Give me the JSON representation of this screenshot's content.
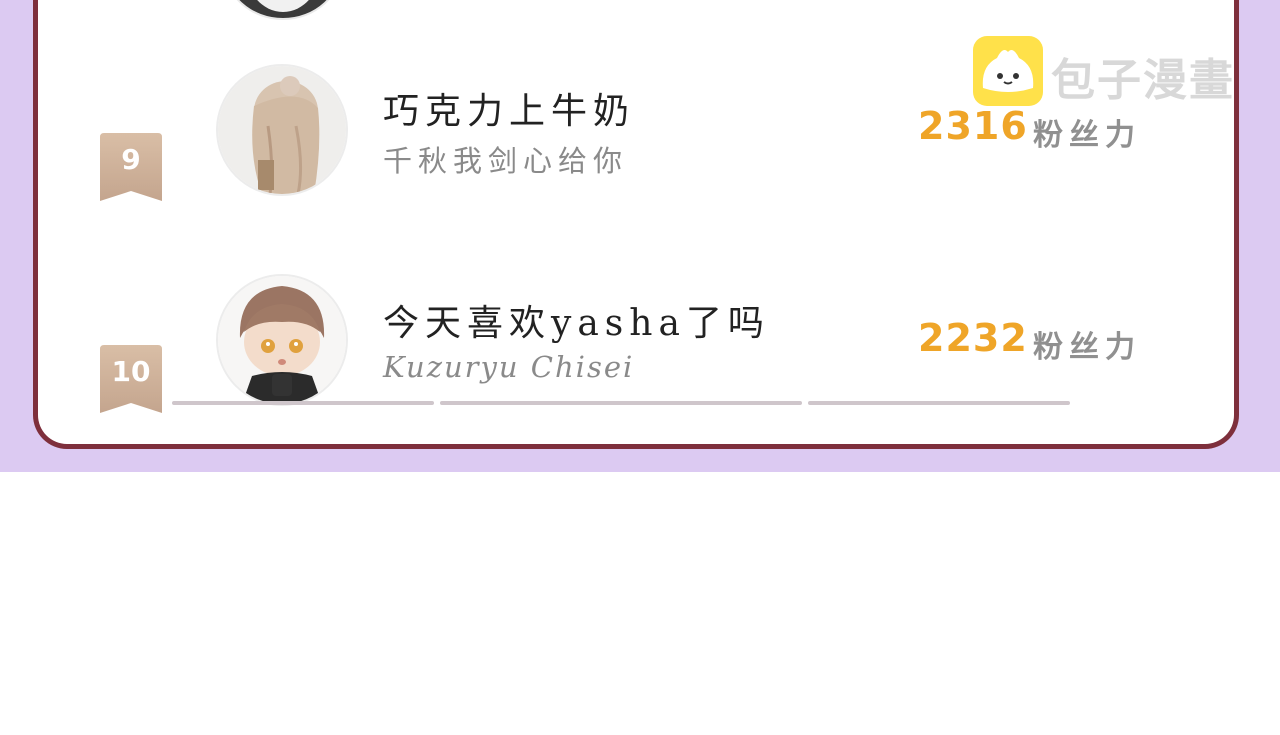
{
  "ranking": {
    "partial_row": {
      "subtitle": "..."
    },
    "rows": [
      {
        "rank": "9",
        "nickname": "巧克力上牛奶",
        "subtitle": "千秋我剑心给你",
        "score": "2316",
        "score_unit": "粉丝力"
      },
      {
        "rank": "10",
        "nickname": "今天喜欢yasha了吗",
        "subtitle": "Kuzuryu Chisei",
        "score": "2232",
        "score_unit": "粉丝力"
      }
    ]
  },
  "watermark": {
    "text": "包子漫畫",
    "icon": "bun-mascot-icon"
  },
  "colors": {
    "background_band": "#dccaf2",
    "card_border": "#7e2f3c",
    "score": "#efa528",
    "rank_badge": "#c9ab93"
  }
}
